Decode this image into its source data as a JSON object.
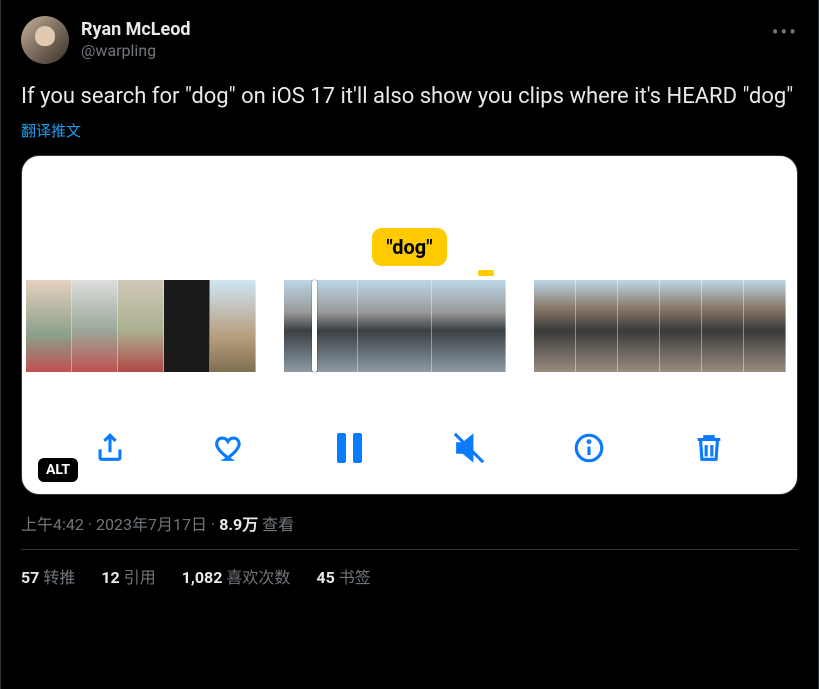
{
  "user": {
    "display_name": "Ryan McLeod",
    "handle": "@warpling"
  },
  "tweet_text": "If you search for \"dog\" on iOS 17 it'll also show you clips where it's HEARD \"dog\"",
  "translate_label": "翻译推文",
  "media": {
    "tooltip": "\"dog\"",
    "alt_badge": "ALT",
    "toolbar_icons": {
      "share": "share-icon",
      "like": "heart-icon",
      "pause": "pause-icon",
      "mute": "mute-icon",
      "info": "info-icon",
      "trash": "trash-icon"
    }
  },
  "meta": {
    "time": "上午4:42",
    "date": "2023年7月17日",
    "views_count": "8.9万",
    "views_label": "查看"
  },
  "stats": {
    "retweets": {
      "count": "57",
      "label": "转推"
    },
    "quotes": {
      "count": "12",
      "label": "引用"
    },
    "likes": {
      "count": "1,082",
      "label": "喜欢次数"
    },
    "bookmarks": {
      "count": "45",
      "label": "书签"
    }
  }
}
